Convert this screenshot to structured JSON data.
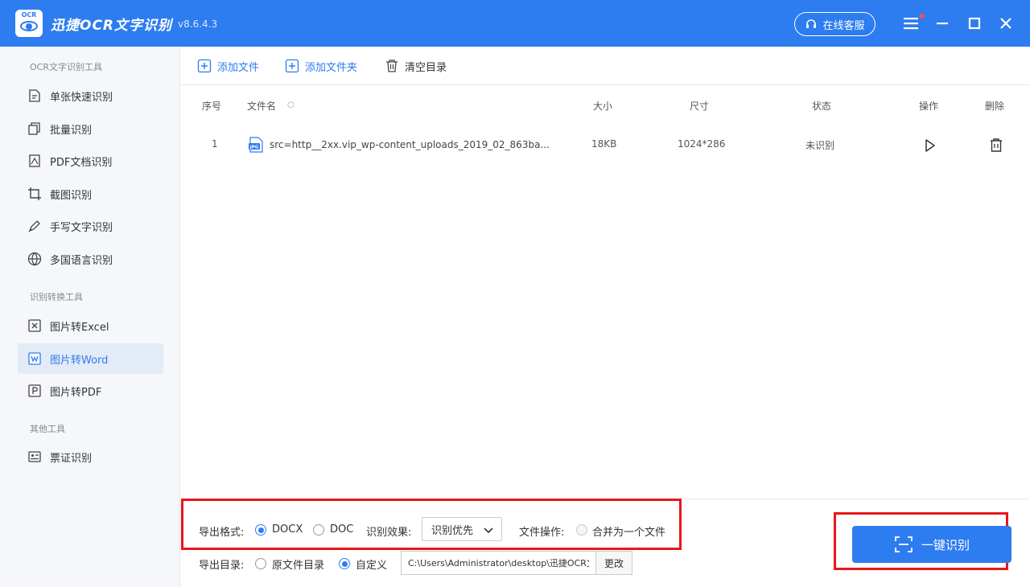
{
  "titlebar": {
    "logo_text": "OCR",
    "title": "迅捷OCR文字识别",
    "version": "v8.6.4.3",
    "service_label": "在线客服"
  },
  "sidebar": {
    "section1": "OCR文字识别工具",
    "items1": [
      {
        "label": "单张快速识别",
        "icon": "single-scan-icon"
      },
      {
        "label": "批量识别",
        "icon": "batch-icon"
      },
      {
        "label": "PDF文档识别",
        "icon": "pdf-doc-icon"
      },
      {
        "label": "截图识别",
        "icon": "crop-icon"
      },
      {
        "label": "手写文字识别",
        "icon": "pen-icon"
      },
      {
        "label": "多国语言识别",
        "icon": "globe-icon"
      }
    ],
    "section2": "识别转换工具",
    "items2": [
      {
        "label": "图片转Excel",
        "icon": "excel-icon"
      },
      {
        "label": "图片转Word",
        "icon": "word-icon",
        "active": true
      },
      {
        "label": "图片转PDF",
        "icon": "pdf-icon"
      }
    ],
    "section3": "其他工具",
    "items3": [
      {
        "label": "票证识别",
        "icon": "ticket-icon"
      }
    ]
  },
  "toolbar": {
    "add_file": "添加文件",
    "add_folder": "添加文件夹",
    "clear_list": "清空目录"
  },
  "table": {
    "headers": {
      "index": "序号",
      "filename": "文件名",
      "size": "大小",
      "dimensions": "尺寸",
      "status": "状态",
      "action": "操作",
      "delete": "删除"
    },
    "rows": [
      {
        "index": "1",
        "filename": "src=http__2xx.vip_wp-content_uploads_2019_02_863ba...",
        "size": "18KB",
        "dimensions": "1024*286",
        "status": "未识别"
      }
    ]
  },
  "settings": {
    "format_label": "导出格式:",
    "format_docx": "DOCX",
    "format_doc": "DOC",
    "format_selected": "DOCX",
    "effect_label": "识别效果:",
    "effect_value": "识别优先",
    "file_op_label": "文件操作:",
    "merge_label": "合并为一个文件",
    "dir_label": "导出目录:",
    "dir_original": "原文件目录",
    "dir_custom": "自定义",
    "dir_selected": "自定义",
    "path_value": "C:\\Users\\Administrator\\desktop\\迅捷OCR文",
    "change_label": "更改",
    "ocr_button": "一键识别"
  },
  "colors": {
    "primary": "#2d7cf0",
    "highlight_red": "#e8161b",
    "sidebar_bg": "#f5f7fa",
    "active_bg": "#e3ebf7"
  }
}
